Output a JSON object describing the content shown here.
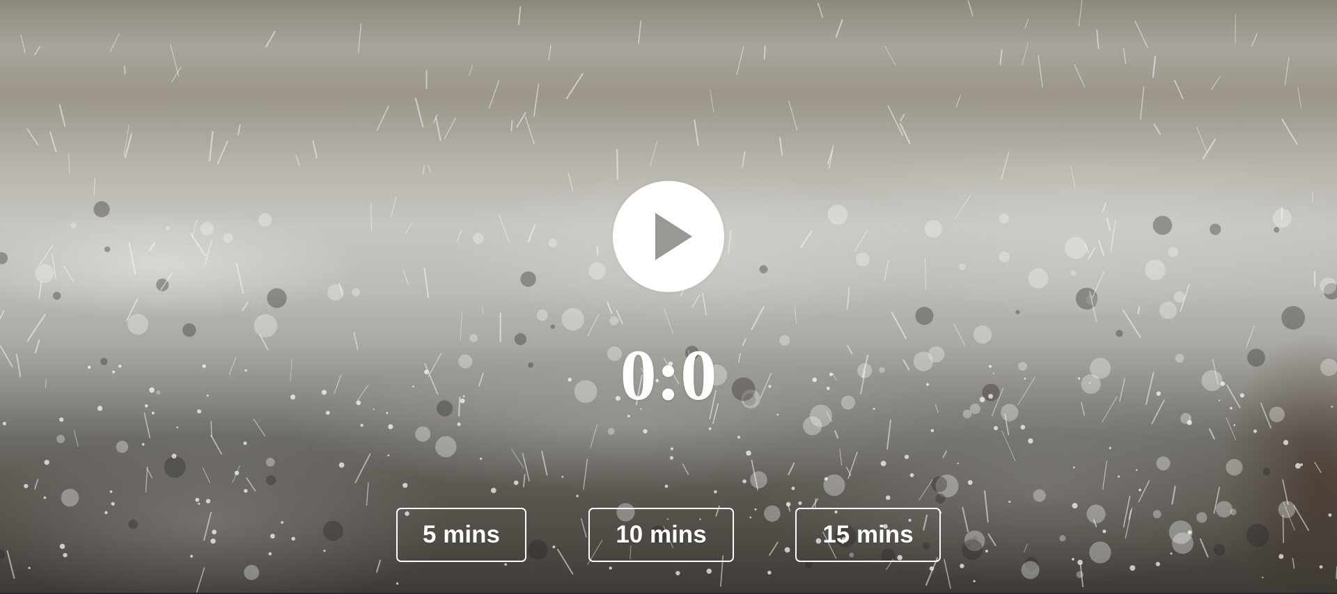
{
  "player": {
    "play_icon": "play-icon",
    "timer": "0:0"
  },
  "durations": [
    {
      "label": "5 mins"
    },
    {
      "label": "10 mins"
    },
    {
      "label": "15 mins"
    }
  ],
  "colors": {
    "foreground": "#ffffff",
    "background": "#9e9c95"
  }
}
